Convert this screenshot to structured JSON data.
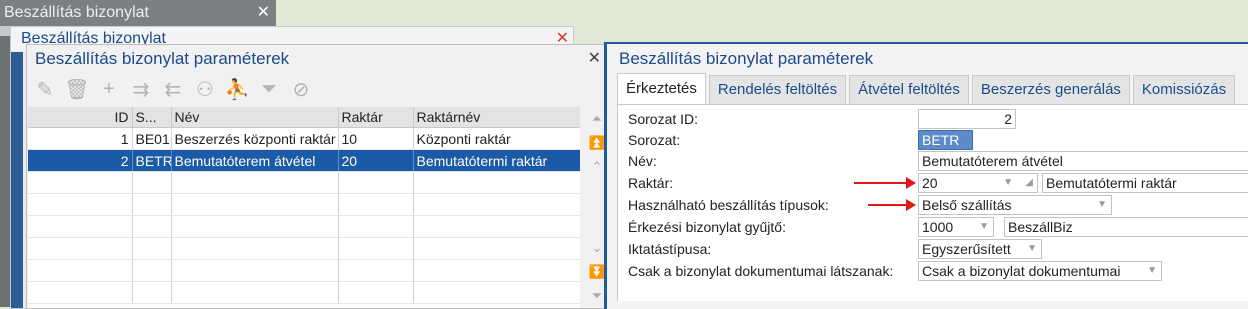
{
  "bg_window": {
    "title": "Beszállítás bizonylat",
    "close": "✕"
  },
  "mid_window": {
    "title": "Beszállítás bizonylat",
    "close": "✕"
  },
  "list_window": {
    "title": "Beszállítás bizonylat paraméterek",
    "close": "✕",
    "columns": [
      "ID",
      "S...",
      "Név",
      "Raktár",
      "Raktárnév"
    ],
    "rows": [
      [
        "1",
        "BE01",
        "Beszerzés központi raktár",
        "10",
        "Központi raktár"
      ],
      [
        "2",
        "BETR",
        "Bemutatóterem átvétel",
        "20",
        "Bemutatótermi raktár"
      ]
    ],
    "selected_row": 1
  },
  "detail_panel": {
    "title": "Beszállítás bizonylat paraméterek",
    "tabs": [
      "Érkeztetés",
      "Rendelés feltöltés",
      "Átvétel feltöltés",
      "Beszerzés generálás",
      "Komissiózás"
    ],
    "active_tab": 0,
    "fields": {
      "sorozat_id": {
        "label": "Sorozat ID:",
        "value": "2"
      },
      "sorozat": {
        "label": "Sorozat:",
        "value": "BETR"
      },
      "nev": {
        "label": "Név:",
        "value": "Bemutatóterem átvétel"
      },
      "raktar": {
        "label": "Raktár:",
        "value": "20",
        "name": "Bemutatótermi raktár"
      },
      "tipusok": {
        "label": "Használható beszállítás típusok:",
        "value": "Belső szállítás"
      },
      "gyujto": {
        "label": "Érkezési bizonylat gyűjtő:",
        "value": "1000",
        "name": "BeszállBiz"
      },
      "iktatas": {
        "label": "Iktatástípusa:",
        "value": "Egyszerűsített"
      },
      "csak": {
        "label": "Csak a bizonylat dokumentumai látszanak:",
        "value": "Csak a bizonylat dokumentumai"
      }
    }
  },
  "colors": {
    "accent": "#1b4b8a",
    "selection": "#1a5aa6",
    "annotation": "#e01818"
  }
}
